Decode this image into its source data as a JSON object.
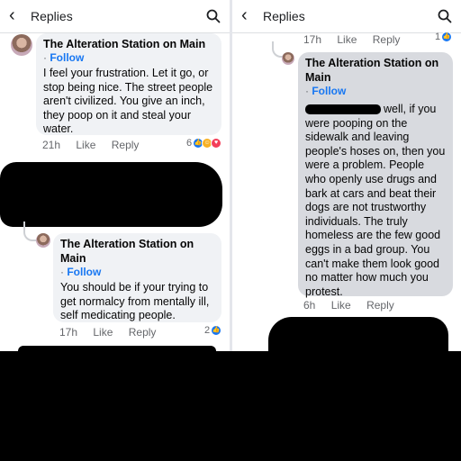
{
  "left": {
    "header": {
      "title": "Replies"
    },
    "comment1": {
      "author": "The Alteration Station on Main",
      "follow": "Follow",
      "text": "I feel your frustration. Let it go, or stop being nice. The street people aren't civilized. You give an inch, they poop on it and steal your water.",
      "time": "21h",
      "like": "Like",
      "reply": "Reply",
      "reaction_count": "6"
    },
    "comment2": {
      "author": "The Alteration Station on Main",
      "follow": "Follow",
      "text": "You should be if your trying to get normalcy from mentally ill, self medicating people.",
      "time": "17h",
      "like": "Like",
      "reply": "Reply",
      "reaction_count": "2"
    }
  },
  "right": {
    "header": {
      "title": "Replies"
    },
    "prev_meta": {
      "time": "17h",
      "like": "Like",
      "reply": "Reply",
      "reaction_count": "1"
    },
    "comment": {
      "author": "The Alteration Station on Main",
      "follow": "Follow",
      "text": "well, if you were pooping on the sidewalk and leaving people's hoses on, then you were a problem. People who openly use drugs and bark at cars and beat their dogs are not trustworthy individuals. The truly homeless are the few good eggs in a bad group. You can't make them look good no matter how much you protest.",
      "time": "6h",
      "like": "Like",
      "reply": "Reply"
    }
  },
  "colors": {
    "link": "#1877f2",
    "bubble": "#f0f2f5",
    "bubble_dark": "#d8dadf",
    "meta": "#65676b",
    "like_blue": "#1877f2",
    "heart_red": "#f33e58",
    "haha_yellow": "#f7b125"
  },
  "icons": {
    "back": "chevron-left-icon",
    "search": "search-icon"
  }
}
